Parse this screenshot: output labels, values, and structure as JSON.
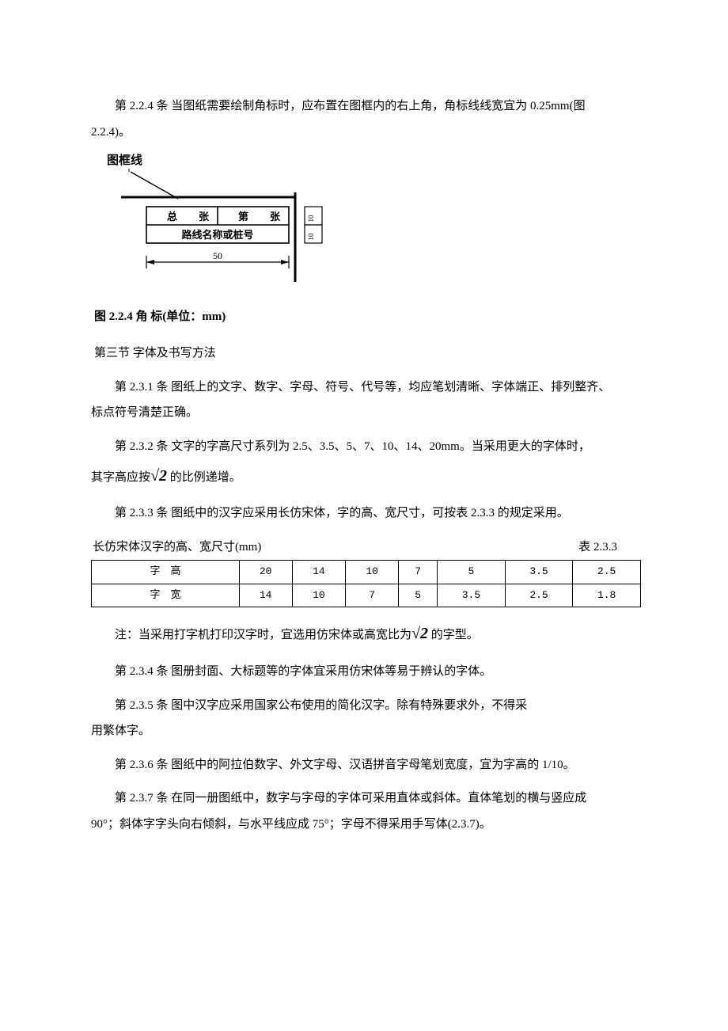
{
  "p224": {
    "prefix": "第 2.2.4 条",
    "text_a": "  当图纸需要绘制角标时，应布置在图框内的右上角，角标线线宽宜为 0.25mm(图",
    "text_b": "2.2.4)。"
  },
  "fig224": {
    "tklabel": "图框线",
    "zong": "总",
    "zhang1": "张",
    "di": "第",
    "zhang2": "张",
    "line2": "路线名称或桩号",
    "dim_w": "50",
    "dim_h1": "10",
    "dim_h2": "10",
    "caption": "图 2.2.4   角     标(单位：mm)"
  },
  "sec3_title": "第三节   字体及书写方法",
  "p231": {
    "prefix": "第 2.3.1 条",
    "text_a": "  图纸上的文字、数字、字母、符号、代号等，均应笔划清晰、字体端正、排列整齐、",
    "text_b": "标点符号清楚正确。"
  },
  "p232": {
    "prefix": "第 2.3.2 条",
    "text_a": "  文字的字高尺寸系列为 2.5、3.5、5、7、10、14、20mm。当采用更大的字体时，",
    "text_b1": "其字高应按",
    "sqrt": "√2",
    "text_b2": " 的比例递增。"
  },
  "p233": {
    "prefix": "第 2.3.3 条",
    "text": "  图纸中的汉字应采用长仿宋体，字的高、宽尺寸，可按表 2.3.3 的规定采用。"
  },
  "table233": {
    "title_left": "长仿宋体汉字的高、宽尺寸(mm)",
    "title_right": "表 2.3.3",
    "rows": [
      {
        "label": "字高",
        "v": [
          "20",
          "14",
          "10",
          "7",
          "5",
          "3.5",
          "2.5"
        ]
      },
      {
        "label": "字宽",
        "v": [
          "14",
          "10",
          "7",
          "5",
          "3.5",
          "2.5",
          "1.8"
        ]
      }
    ]
  },
  "note233": {
    "pre": "注：当采用打字机打印汉字时，宜选用仿宋体或高宽比为",
    "sqrt": "√2",
    "post": " 的字型。"
  },
  "p234": {
    "prefix": "第 2.3.4 条",
    "text": "  图册封面、大标题等的字体宜采用仿宋体等易于辨认的字体。"
  },
  "p235": {
    "prefix": "第 2.3.5 条",
    "text_a": "  图中汉字应采用国家公布使用的简化汉字。除有特殊要求外，不得采",
    "text_b": "用繁体字。"
  },
  "p236": {
    "prefix": "第 2.3.6 条",
    "text": "  图纸中的阿拉伯数字、外文字母、汉语拼音字母笔划宽度，宜为字高的 1/10。"
  },
  "p237": {
    "prefix": "第 2.3.7 条",
    "text_a": "  在同一册图纸中，数字与字母的字体可采用直体或斜体。直体笔划的横与竖应成",
    "text_b": "90°；斜体字字头向右倾斜，与水平线应成 75°；字母不得采用手写体(2.3.7)。"
  },
  "chart_data": {
    "type": "table",
    "title": "长仿宋体汉字的高、宽尺寸(mm) — 表 2.3.3",
    "categories": [
      "20",
      "14",
      "10",
      "7",
      "5",
      "3.5",
      "2.5"
    ],
    "series": [
      {
        "name": "字高",
        "values": [
          20,
          14,
          10,
          7,
          5,
          3.5,
          2.5
        ]
      },
      {
        "name": "字宽",
        "values": [
          14,
          10,
          7,
          5,
          3.5,
          2.5,
          1.8
        ]
      }
    ]
  }
}
